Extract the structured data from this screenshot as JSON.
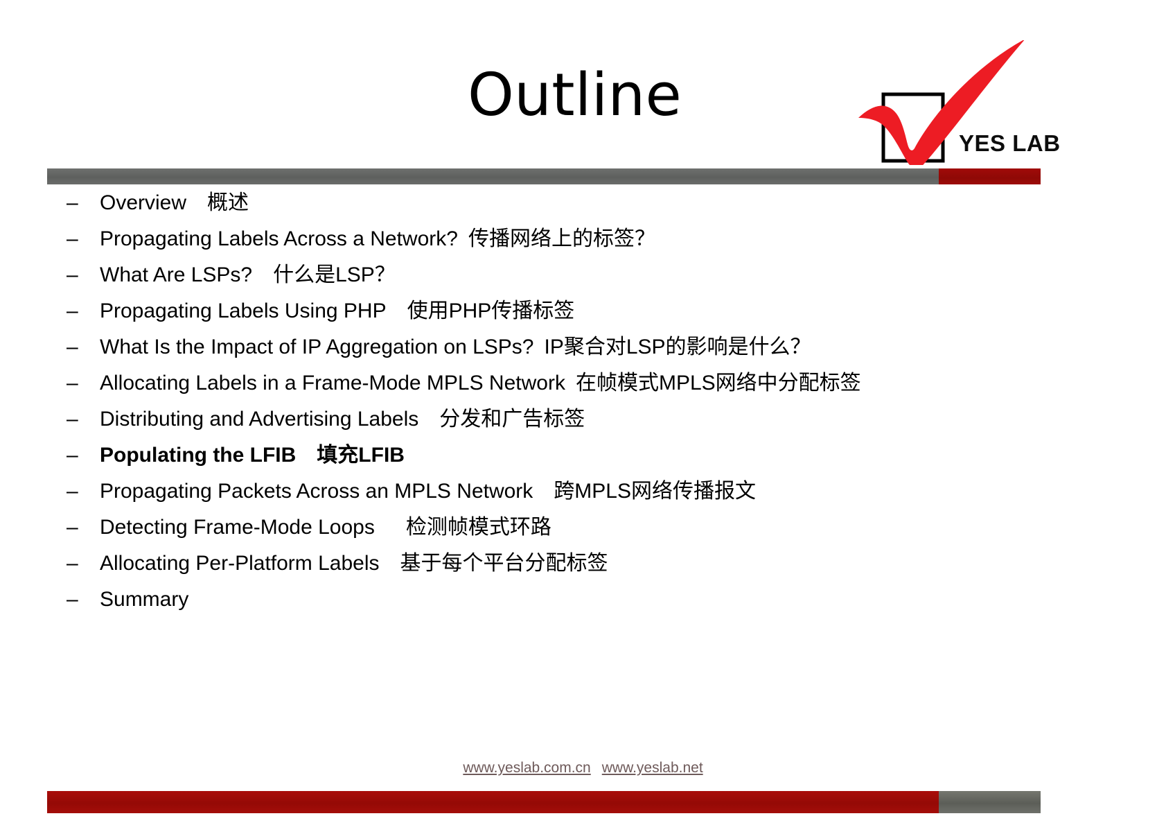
{
  "slide": {
    "title": "Outline",
    "logo": {
      "brand_text": "YES LAB",
      "check_color": "#ED1C24",
      "box_color": "#000000"
    },
    "accent_colors": {
      "gray": "#606260",
      "red": "#9c0b07"
    }
  },
  "bullets": [
    {
      "dash": "–",
      "text": "Overview 概述"
    },
    {
      "dash": "–",
      "text": "Propagating Labels Across a Network? 传播网络上的标签？"
    },
    {
      "dash": "–",
      "text": "What Are LSPs? 什么是LSP？"
    },
    {
      "dash": "–",
      "text": "Propagating Labels Using PHP 使用PHP传播标签"
    },
    {
      "dash": "–",
      "text": "What Is the Impact of IP Aggregation on LSPs? IP聚合对LSP的影响是什么？"
    },
    {
      "dash": "–",
      "text": "Allocating Labels in a Frame-Mode MPLS Network 在帧模式MPLS网络中分配标签"
    },
    {
      "dash": "–",
      "text": "Distributing and Advertising Labels 分发和广告标签"
    },
    {
      "dash": "–",
      "text": "Populating the LFIB 填充LFIB",
      "bold": true
    },
    {
      "dash": "–",
      "text": "Propagating Packets Across an MPLS Network 跨MPLS网络传播报文"
    },
    {
      "dash": "–",
      "text": "Detecting Frame-Mode Loops  检测帧模式环路"
    },
    {
      "dash": "–",
      "text": "Allocating Per-Platform Labels 基于每个平台分配标签"
    },
    {
      "dash": "–",
      "text": "Summary"
    }
  ],
  "footer": {
    "link1": "www.yeslab.com.cn",
    "link2": "www.yeslab.net"
  }
}
